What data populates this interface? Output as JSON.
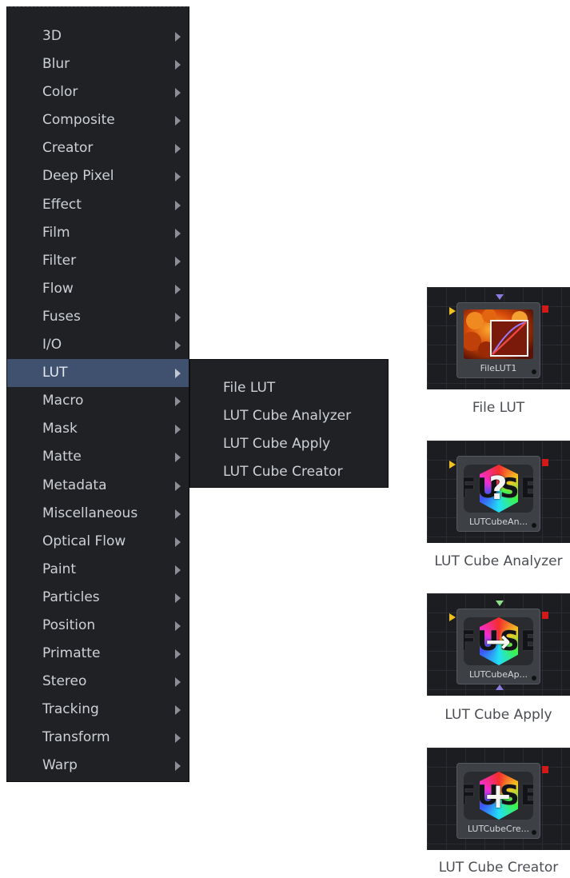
{
  "menu": {
    "items": [
      {
        "label": "3D"
      },
      {
        "label": "Blur"
      },
      {
        "label": "Color"
      },
      {
        "label": "Composite"
      },
      {
        "label": "Creator"
      },
      {
        "label": "Deep Pixel"
      },
      {
        "label": "Effect"
      },
      {
        "label": "Film"
      },
      {
        "label": "Filter"
      },
      {
        "label": "Flow"
      },
      {
        "label": "Fuses"
      },
      {
        "label": "I/O"
      },
      {
        "label": "LUT",
        "active": true
      },
      {
        "label": "Macro"
      },
      {
        "label": "Mask"
      },
      {
        "label": "Matte"
      },
      {
        "label": "Metadata"
      },
      {
        "label": "Miscellaneous"
      },
      {
        "label": "Optical Flow"
      },
      {
        "label": "Paint"
      },
      {
        "label": "Particles"
      },
      {
        "label": "Position"
      },
      {
        "label": "Primatte"
      },
      {
        "label": "Stereo"
      },
      {
        "label": "Tracking"
      },
      {
        "label": "Transform"
      },
      {
        "label": "Warp"
      }
    ]
  },
  "submenu": {
    "items": [
      {
        "label": "File LUT"
      },
      {
        "label": "LUT Cube Analyzer"
      },
      {
        "label": "LUT Cube Apply"
      },
      {
        "label": "LUT Cube Creator"
      }
    ]
  },
  "tiles": [
    {
      "node_label": "FileLUT1",
      "caption": "File LUT",
      "icon": "file-lut-icon"
    },
    {
      "node_label": "LUTCubeAn...",
      "caption": "LUT Cube Analyzer",
      "icon": "lut-cube-analyzer-icon",
      "glyph": "?"
    },
    {
      "node_label": "LUTCubeAp...",
      "caption": "LUT Cube Apply",
      "icon": "lut-cube-apply-icon",
      "glyph": "→"
    },
    {
      "node_label": "LUTCubeCre...",
      "caption": "LUT Cube Creator",
      "icon": "lut-cube-creator-icon",
      "glyph": "+"
    }
  ],
  "fuse_text": "FUSE",
  "colors": {
    "menu_bg": "#1f2125",
    "menu_active": "#3f516f",
    "node_bg": "#3d4044",
    "input_port": "#f0c020",
    "output_port": "#d01a1a",
    "mask_port": "#8a7be0"
  }
}
